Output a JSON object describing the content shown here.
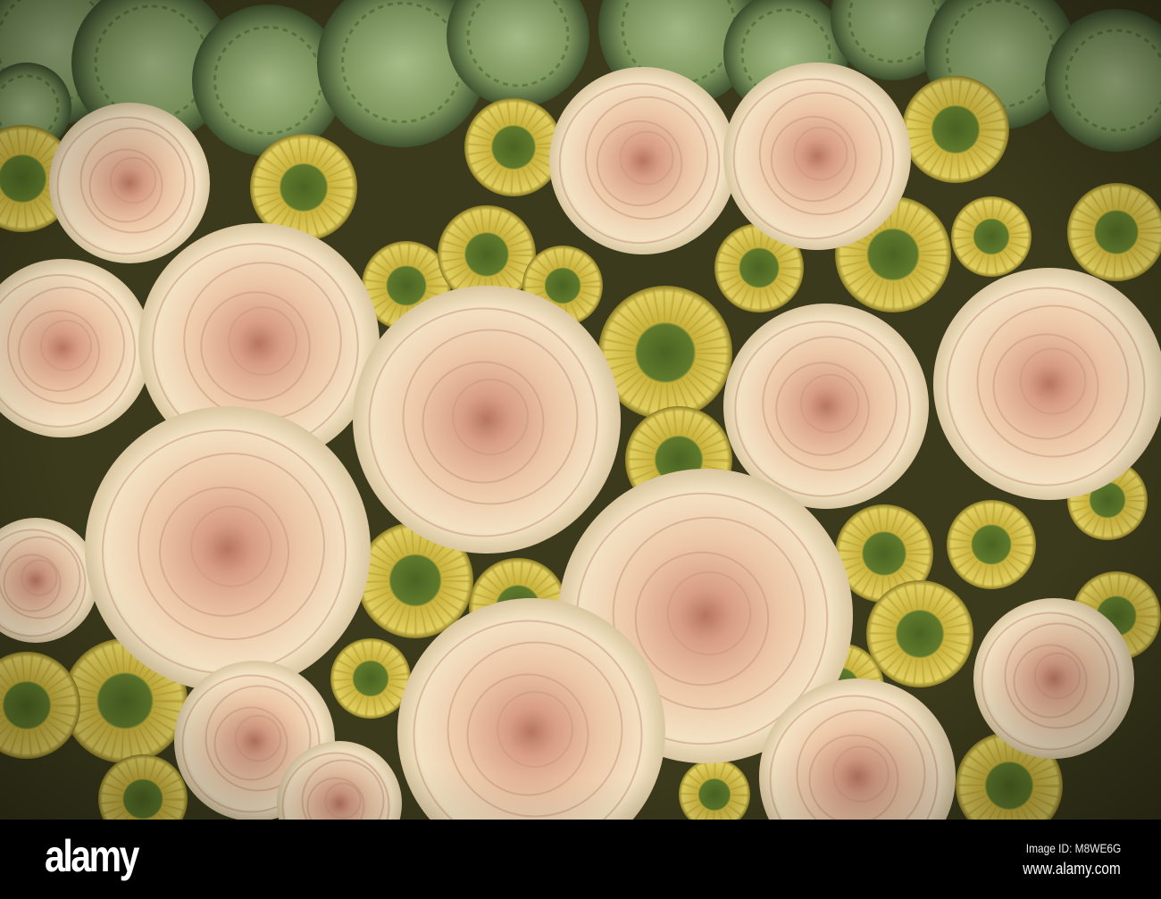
{
  "photo": {
    "subject": "roses-daisies-carnations",
    "colors": {
      "rose_center": "#c98f78",
      "rose_mid": "#ecc6a6",
      "rose_outer": "#f3e2c2",
      "daisy_petal": "#d6c24c",
      "daisy_center": "#55702a",
      "carnation": "#8fa86e",
      "background": "#3b3a1c"
    }
  },
  "footer": {
    "logo": "alamy",
    "image_id": "Image ID: M8WE6G",
    "url": "www.alamy.com"
  }
}
